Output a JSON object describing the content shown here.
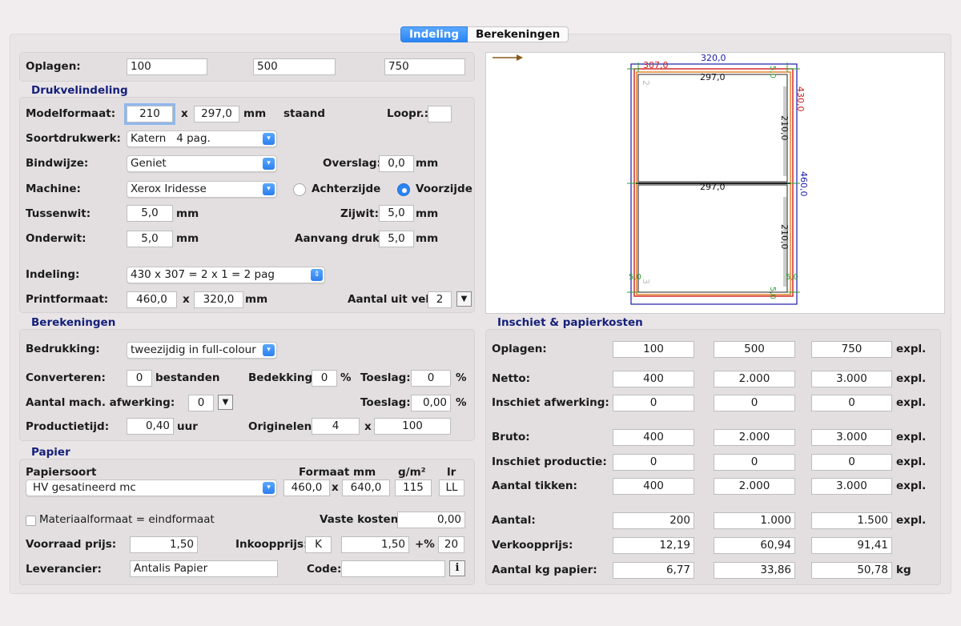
{
  "tabs": [
    "Indeling",
    "Berekeningen"
  ],
  "oplagen": {
    "label": "Oplagen:",
    "values": [
      "100",
      "500",
      "750"
    ]
  },
  "drukvel": {
    "title": "Drukvelindeling",
    "modelformaat_label": "Modelformaat:",
    "model_w": "210",
    "x1": "x",
    "model_h": "297,0",
    "mm1": "mm",
    "orientation": "staand",
    "loopr_label": "Loopr.:",
    "loopr_value": "",
    "soortdrukwerk_label": "Soortdrukwerk:",
    "soortdrukwerk_value": "Katern   4 pag.",
    "bindwijze_label": "Bindwijze:",
    "bindwijze_value": "Geniet",
    "overslag_label": "Overslag:",
    "overslag_value": "0,0",
    "mm_overslag": "mm",
    "machine_label": "Machine:",
    "machine_value": "Xerox Iridesse",
    "achterzijde": "Achterzijde",
    "voorzijde": "Voorzijde",
    "tussenwit_label": "Tussenwit:",
    "tussenwit_value": "5,0",
    "mm_tussenwit": "mm",
    "zijwit_label": "Zijwit:",
    "zijwit_value": "5,0",
    "mm_zijwit": "mm",
    "onderwit_label": "Onderwit:",
    "onderwit_value": "5,0",
    "mm_onderwit": "mm",
    "aanvang_label": "Aanvang druk:",
    "aanvang_value": "5,0",
    "mm_aanvang": "mm",
    "indeling_label": "Indeling:",
    "indeling_value": "430 x 307 = 2 x 1 = 2 pag",
    "printformaat_label": "Printformaat:",
    "print_w": "460,0",
    "x2": "x",
    "print_h": "320,0",
    "mm_print": "mm",
    "aantal_uit_vel_label": "Aantal uit vel:",
    "aantal_uit_vel_value": "2"
  },
  "preview": {
    "dim_top_blue": "320,0",
    "dim_top_red": "307,0",
    "dim_right_red": "430,0",
    "dim_right_blue": "460,0",
    "page_top_w": "297,0",
    "page_bottom_w": "297,0",
    "page_top_h": "210,0",
    "page_bottom_h": "210,0",
    "margin_green": "5,0",
    "page_num_top": "2",
    "page_num_bottom": "3",
    "colors": {
      "blue": "#1a1aa8",
      "red": "#d01c1c",
      "orange": "#e07a1e",
      "green": "#2ca02c"
    }
  },
  "berekeningen": {
    "title": "Berekeningen",
    "bedrukking_label": "Bedrukking:",
    "bedrukking_value": "tweezijdig in full-colour",
    "converteren_label": "Converteren:",
    "converteren_value": "0",
    "bestanden": "bestanden",
    "bedekking_label": "Bedekking:",
    "bedekking_value": "0",
    "pct1": "%",
    "toeslag1_label": "Toeslag:",
    "toeslag1_value": "0",
    "pct2": "%",
    "mach_afwerking_label": "Aantal mach. afwerking:",
    "mach_afwerking_value": "0",
    "toeslag2_label": "Toeslag:",
    "toeslag2_value": "0,00",
    "pct3": "%",
    "productietijd_label": "Productietijd:",
    "productietijd_value": "0,40",
    "uur": "uur",
    "originelen_label": "Originelen:",
    "originelen_value": "4",
    "x3": "x",
    "originelen_aantal": "100"
  },
  "papier": {
    "title": "Papier",
    "papiersoort_label": "Papiersoort",
    "formaat_label": "Formaat mm",
    "gm2_label": "g/m²",
    "lr_label": "lr",
    "papiersoort_value": "HV gesatineerd mc",
    "formaat_w": "460,0",
    "x4": "x",
    "formaat_h": "640,0",
    "gm2_value": "115",
    "lr_value": "LL",
    "materiaal_label": "Materiaalformaat = eindformaat",
    "vaste_kosten_label": "Vaste kosten:",
    "vaste_kosten_value": "0,00",
    "voorraad_label": "Voorraad prijs:",
    "voorraad_value": "1,50",
    "inkoop_label": "Inkoopprijs:",
    "inkoop_code": "K",
    "inkoop_value": "1,50",
    "plus_pct": "+%",
    "plus_pct_value": "20",
    "leverancier_label": "Leverancier:",
    "leverancier_value": "Antalis Papier",
    "code_label": "Code:",
    "code_value": "",
    "info_button": "i"
  },
  "inschiet": {
    "title": "Inschiet & papierkosten",
    "rows": [
      {
        "label": "Oplagen:",
        "values": [
          "100",
          "500",
          "750"
        ],
        "unit": "expl.",
        "align": "c"
      },
      {
        "label": "Netto:",
        "values": [
          "400",
          "2.000",
          "3.000"
        ],
        "unit": "expl.",
        "align": "c"
      },
      {
        "label": "Inschiet afwerking:",
        "values": [
          "0",
          "0",
          "0"
        ],
        "unit": "expl.",
        "align": "c"
      },
      {
        "label": "Bruto:",
        "values": [
          "400",
          "2.000",
          "3.000"
        ],
        "unit": "expl.",
        "align": "c"
      },
      {
        "label": "Inschiet productie:",
        "values": [
          "0",
          "0",
          "0"
        ],
        "unit": "expl.",
        "align": "c"
      },
      {
        "label": "Aantal tikken:",
        "values": [
          "400",
          "2.000",
          "3.000"
        ],
        "unit": "expl.",
        "align": "c"
      },
      {
        "label": "Aantal:",
        "values": [
          "200",
          "1.000",
          "1.500"
        ],
        "unit": "expl.",
        "align": "r"
      },
      {
        "label": "Verkoopprijs:",
        "values": [
          "12,19",
          "60,94",
          "91,41"
        ],
        "unit": "",
        "align": "r"
      },
      {
        "label": "Aantal kg papier:",
        "values": [
          "6,77",
          "33,86",
          "50,78"
        ],
        "unit": "kg",
        "align": "r"
      }
    ]
  }
}
